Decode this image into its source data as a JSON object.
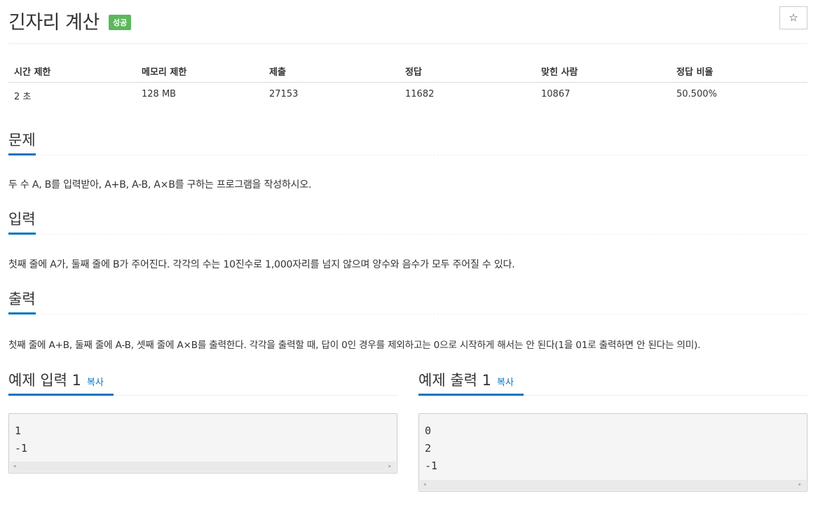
{
  "problem": {
    "title": "긴자리 계산",
    "badge": "성공",
    "star_icon": "☆"
  },
  "stats": {
    "headers": [
      "시간 제한",
      "메모리 제한",
      "제출",
      "정답",
      "맞힌 사람",
      "정답 비율"
    ],
    "values": [
      "2 초",
      "128 MB",
      "27153",
      "11682",
      "10867",
      "50.500%"
    ]
  },
  "sections": {
    "problem": {
      "heading": "문제",
      "text": "두 수 A, B를 입력받아, A+B, A-B, A×B를 구하는 프로그램을 작성하시오."
    },
    "input": {
      "heading": "입력",
      "text": "첫째 줄에 A가, 둘째 줄에 B가 주어진다. 각각의 수는 10진수로 1,000자리를 넘지 않으며 양수와 음수가 모두 주어질 수 있다."
    },
    "output": {
      "heading": "출력",
      "text": "첫째 줄에 A+B, 둘째 줄에 A-B, 셋째 줄에 A×B를 출력한다. 각각을 출력할 때, 답이 0인 경우를 제외하고는 0으로 시작하게 해서는 안 된다(1을 01로 출력하면 안 된다는 의미)."
    }
  },
  "samples": {
    "input": {
      "heading": "예제 입력 1",
      "copy": "복사",
      "lines": [
        "1",
        "-1"
      ]
    },
    "output": {
      "heading": "예제 출력 1",
      "copy": "복사",
      "lines": [
        "0",
        "2",
        "-1"
      ]
    }
  },
  "colors": {
    "accent": "#0076c0",
    "badge": "#5cb85c"
  },
  "icons": {
    "scroll_left": "◂",
    "scroll_right": "▸"
  }
}
